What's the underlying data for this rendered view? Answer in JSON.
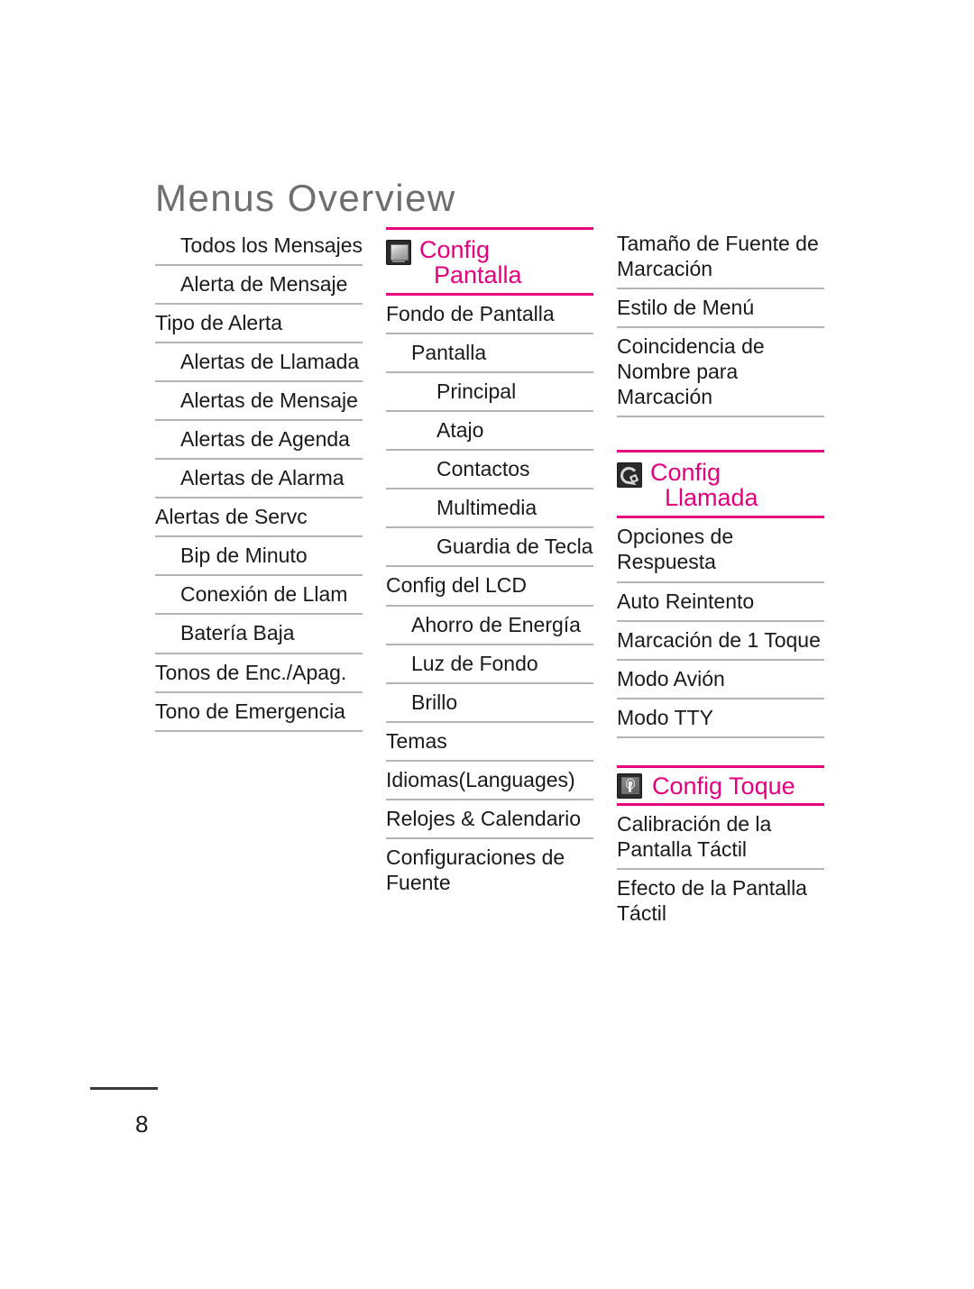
{
  "document": {
    "title": "Menus Overview",
    "page_number": "8",
    "accent_color": "#e5007d",
    "title_color": "#6e6e6e",
    "rule_color": "#b3b3b3"
  },
  "columns": [
    {
      "id": "column-1",
      "sections": [
        {
          "header": null,
          "items": [
            {
              "label": "Todos los Mensajes",
              "level": 1
            },
            {
              "label": "Alerta de Mensaje",
              "level": 1
            },
            {
              "label": "Tipo de Alerta",
              "level": 0
            },
            {
              "label": "Alertas de Llamada",
              "level": 1
            },
            {
              "label": "Alertas de Mensaje",
              "level": 1
            },
            {
              "label": "Alertas de Agenda",
              "level": 1
            },
            {
              "label": "Alertas de Alarma",
              "level": 1
            },
            {
              "label": "Alertas de Servc",
              "level": 0
            },
            {
              "label": "Bip de Minuto",
              "level": 1
            },
            {
              "label": "Conexión de Llam",
              "level": 1
            },
            {
              "label": "Batería Baja",
              "level": 1
            },
            {
              "label": "Tonos de Enc./Apag.",
              "level": 0
            },
            {
              "label": "Tono de Emergencia",
              "level": 0
            }
          ]
        }
      ]
    },
    {
      "id": "column-2",
      "sections": [
        {
          "header": {
            "icon": "display-icon",
            "line1": "Config",
            "line2": "Pantalla",
            "style": "stacked"
          },
          "items": [
            {
              "label": "Fondo de Pantalla",
              "level": 0
            },
            {
              "label": "Pantalla",
              "level": 1
            },
            {
              "label": "Principal",
              "level": 2
            },
            {
              "label": "Atajo",
              "level": 2
            },
            {
              "label": "Contactos",
              "level": 2
            },
            {
              "label": "Multimedia",
              "level": 2
            },
            {
              "label": "Guardia de Tecla",
              "level": 2
            },
            {
              "label": "Config del LCD",
              "level": 0
            },
            {
              "label": "Ahorro de Energía",
              "level": 1
            },
            {
              "label": "Luz de Fondo",
              "level": 1
            },
            {
              "label": "Brillo",
              "level": 1
            },
            {
              "label": "Temas",
              "level": 0
            },
            {
              "label": "Idiomas(Languages)",
              "level": 0
            },
            {
              "label": "Relojes & Calendario",
              "level": 0
            },
            {
              "label": "Configuraciones de Fuente",
              "level": 0
            }
          ]
        }
      ]
    },
    {
      "id": "column-3",
      "sections": [
        {
          "header": null,
          "items": [
            {
              "label": "Tamaño de Fuente de Marcación",
              "level": 0
            },
            {
              "label": "Estilo de Menú",
              "level": 0
            },
            {
              "label": "Coincidencia de Nombre para Marcación",
              "level": 0
            }
          ]
        },
        {
          "header": {
            "icon": "phone-gear-icon",
            "line1": "Config",
            "line2": "Llamada",
            "style": "stacked"
          },
          "items": [
            {
              "label": "Opciones de Respuesta",
              "level": 0
            },
            {
              "label": "Auto Reintento",
              "level": 0
            },
            {
              "label": "Marcación de 1 Toque",
              "level": 0
            },
            {
              "label": "Modo Avión",
              "level": 0
            },
            {
              "label": "Modo TTY",
              "level": 0
            }
          ]
        },
        {
          "header": {
            "icon": "touch-icon",
            "line1": "Config Toque",
            "line2": null,
            "style": "inline"
          },
          "items": [
            {
              "label": "Calibración de la Pantalla Táctil",
              "level": 0
            },
            {
              "label": "Efecto de la Pantalla Táctil",
              "level": 0
            }
          ]
        }
      ]
    }
  ]
}
